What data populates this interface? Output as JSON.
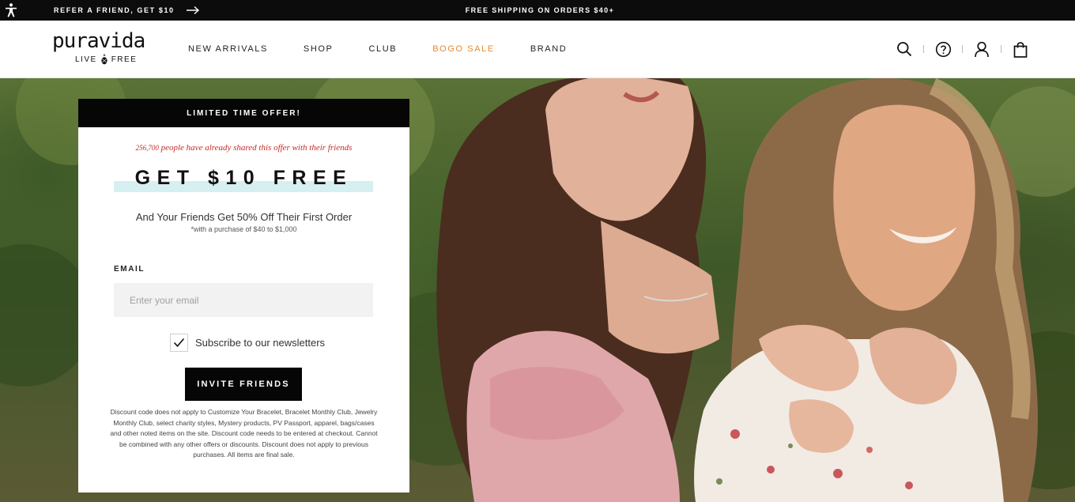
{
  "promo_bar": {
    "refer_text": "REFER A FRIEND, GET $10",
    "shipping_text": "FREE SHIPPING ON ORDERS $40+"
  },
  "header": {
    "logo_word": "puravida",
    "logo_tag_left": "LIVE",
    "logo_tag_right": "FREE",
    "nav": [
      "NEW ARRIVALS",
      "SHOP",
      "CLUB",
      "BOGO SALE",
      "BRAND"
    ],
    "icons": [
      "search-icon",
      "help-icon",
      "account-icon",
      "bag-icon"
    ]
  },
  "offer": {
    "banner": "LIMITED TIME OFFER!",
    "shared_count": "256,700",
    "shared_text": " people have already shared this offer with their friends",
    "headline": "GET $10 FREE",
    "subheadline": "And Your Friends Get 50% Off Their First Order",
    "fine_print": "*with a purchase of $40 to $1,000",
    "email_label": "EMAIL",
    "email_placeholder": "Enter your email",
    "email_value": "",
    "subscribe_label": "Subscribe to our newsletters",
    "subscribe_checked": true,
    "button_label": "INVITE FRIENDS",
    "disclaimer": "Discount code does not apply to Customize Your Bracelet, Bracelet Monthly Club, Jewelry Monthly Club, select charity styles, Mystery products, PV Passport, apparel, bags/cases and other noted items on the site. Discount code needs to be entered at checkout. Cannot be combined with any other offers or discounts. Discount does not apply to previous purchases. All items are final sale."
  },
  "colors": {
    "sale": "#e88a2c",
    "shared_text": "#c62828",
    "headline_highlight": "#d6eff0",
    "dark": "#060606"
  }
}
